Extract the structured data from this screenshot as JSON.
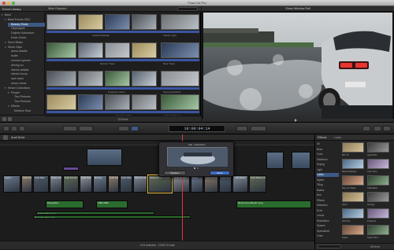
{
  "window": {
    "title": "Final Cut Pro"
  },
  "library": {
    "header": "Event Library",
    "items": [
      {
        "label": "Basil",
        "indent": 0,
        "tri": "▾"
      },
      {
        "label": "Basil Events 2011",
        "indent": 1,
        "tri": "▾"
      },
      {
        "label": "Beauty Shots",
        "indent": 2,
        "tri": "",
        "selected": true
      },
      {
        "label": "Cityscapes",
        "indent": 2,
        "tri": ""
      },
      {
        "label": "Dolphin Adventure",
        "indent": 2,
        "tri": ""
      },
      {
        "label": "Drive Green",
        "indent": 2,
        "tri": ""
      },
      {
        "label": "Short Rides",
        "indent": 1,
        "tri": "▾"
      },
      {
        "label": "Stock Clips",
        "indent": 1,
        "tri": "▾"
      },
      {
        "label": "arena details",
        "indent": 2,
        "tri": ""
      },
      {
        "label": "bullet",
        "indent": 2,
        "tri": ""
      },
      {
        "label": "chrome spinner",
        "indent": 2,
        "tri": ""
      },
      {
        "label": "driving on",
        "indent": 2,
        "tri": ""
      },
      {
        "label": "interior details",
        "indent": 2,
        "tri": ""
      },
      {
        "label": "interior focus",
        "indent": 2,
        "tri": ""
      },
      {
        "label": "race track",
        "indent": 2,
        "tri": ""
      },
      {
        "label": "show rooms",
        "indent": 2,
        "tri": ""
      },
      {
        "label": "Smart Collections",
        "indent": 1,
        "tri": "▾"
      },
      {
        "label": "People",
        "indent": 2,
        "tri": "▾"
      },
      {
        "label": "Two Persons",
        "indent": 3,
        "tri": ""
      },
      {
        "label": "Two Persons",
        "indent": 3,
        "tri": ""
      },
      {
        "label": "Effects",
        "indent": 2,
        "tri": "▾"
      },
      {
        "label": "Medium Shot",
        "indent": 3,
        "tri": ""
      }
    ]
  },
  "browser": {
    "title": "Wide Rejected",
    "captions": [
      "Leftward Ranger",
      "Interior Light",
      "Exterior Trace",
      "Rear Trace",
      "Forgotten Hours",
      "Opening Dolphin",
      "Cleaning Cloth"
    ],
    "clip_count": "25 items"
  },
  "viewer": {
    "title": "Show Window Roll"
  },
  "toolbar": {
    "timecode": "10:00:04:14"
  },
  "timeline": {
    "project": "Audi Drive",
    "title_clips": [
      "Audi Test",
      "Audi Clip 1",
      "Full Tour"
    ],
    "video_clips": [
      {
        "name": "Audi 1"
      },
      {
        "name": "Audi Close"
      },
      {
        "name": "Audi Rain"
      },
      {
        "name": "Wheel Detail"
      },
      {
        "name": "Audi Interior"
      },
      {
        "name": "Audi Rain"
      },
      {
        "name": "Racing"
      },
      {
        "name": "Audi Spin"
      },
      {
        "name": "Audi Wheel"
      },
      {
        "name": "Window Dog"
      },
      {
        "name": "Show Window Roll"
      },
      {
        "name": "Audi Detail"
      },
      {
        "name": "Tires"
      },
      {
        "name": "Audi Interior"
      },
      {
        "name": "Audi Tires"
      },
      {
        "name": "Audi Detail"
      },
      {
        "name": "Audi Wheel Close"
      }
    ],
    "audio_clips": [
      "Drag Race",
      "VRR 2829",
      "Engine Rev Long",
      "Coventry Adv Loop",
      "Nevermore Beach Long"
    ],
    "status": "4:04 selected - 23:52:13 total"
  },
  "popup": {
    "left_button": "Replace",
    "right_button": "Done",
    "title": "Ref - Audi Drive"
  },
  "effects": {
    "header": "Effects",
    "subheader": "Looks",
    "categories": [
      "All",
      "Blurs",
      "Color",
      "Distortion",
      "Keying",
      "Light",
      "Looks",
      "Stylize",
      "Tiling",
      "Basics",
      "Blur",
      "Effects",
      "Distortion",
      "Echo",
      "Levels",
      "Modulation",
      "Spaces",
      "Specialized",
      "Voice"
    ],
    "selected_category": "Looks",
    "looks": [
      "50s TV",
      "Aged Film",
      "Bleach Bypass",
      "Cool Tone",
      "Day into Night",
      "Flashback",
      "Glow",
      "Grunge",
      "Old Film",
      "Projector",
      "Sepia",
      "Super 8mm"
    ],
    "count": "85 items"
  },
  "colors": {
    "selection": "#3d5a86",
    "audio_clip": "#2a6b2e",
    "video_clip": "#4a6080",
    "playhead": "#e03a3a",
    "title_clip": "#6a4a9a"
  }
}
